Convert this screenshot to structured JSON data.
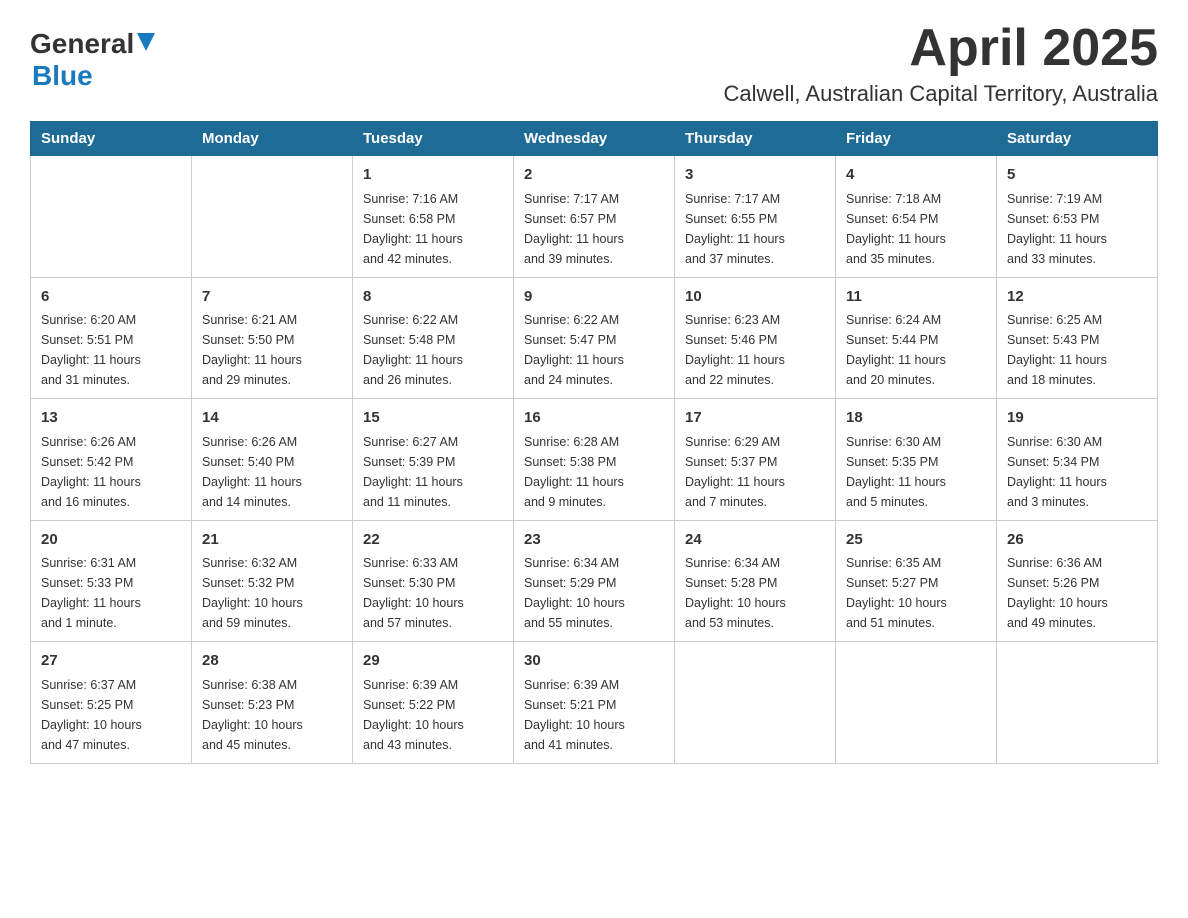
{
  "logo": {
    "general": "General",
    "blue": "Blue"
  },
  "title": "April 2025",
  "subtitle": "Calwell, Australian Capital Territory, Australia",
  "days_of_week": [
    "Sunday",
    "Monday",
    "Tuesday",
    "Wednesday",
    "Thursday",
    "Friday",
    "Saturday"
  ],
  "weeks": [
    [
      {
        "day": "",
        "info": ""
      },
      {
        "day": "",
        "info": ""
      },
      {
        "day": "1",
        "info": "Sunrise: 7:16 AM\nSunset: 6:58 PM\nDaylight: 11 hours\nand 42 minutes."
      },
      {
        "day": "2",
        "info": "Sunrise: 7:17 AM\nSunset: 6:57 PM\nDaylight: 11 hours\nand 39 minutes."
      },
      {
        "day": "3",
        "info": "Sunrise: 7:17 AM\nSunset: 6:55 PM\nDaylight: 11 hours\nand 37 minutes."
      },
      {
        "day": "4",
        "info": "Sunrise: 7:18 AM\nSunset: 6:54 PM\nDaylight: 11 hours\nand 35 minutes."
      },
      {
        "day": "5",
        "info": "Sunrise: 7:19 AM\nSunset: 6:53 PM\nDaylight: 11 hours\nand 33 minutes."
      }
    ],
    [
      {
        "day": "6",
        "info": "Sunrise: 6:20 AM\nSunset: 5:51 PM\nDaylight: 11 hours\nand 31 minutes."
      },
      {
        "day": "7",
        "info": "Sunrise: 6:21 AM\nSunset: 5:50 PM\nDaylight: 11 hours\nand 29 minutes."
      },
      {
        "day": "8",
        "info": "Sunrise: 6:22 AM\nSunset: 5:48 PM\nDaylight: 11 hours\nand 26 minutes."
      },
      {
        "day": "9",
        "info": "Sunrise: 6:22 AM\nSunset: 5:47 PM\nDaylight: 11 hours\nand 24 minutes."
      },
      {
        "day": "10",
        "info": "Sunrise: 6:23 AM\nSunset: 5:46 PM\nDaylight: 11 hours\nand 22 minutes."
      },
      {
        "day": "11",
        "info": "Sunrise: 6:24 AM\nSunset: 5:44 PM\nDaylight: 11 hours\nand 20 minutes."
      },
      {
        "day": "12",
        "info": "Sunrise: 6:25 AM\nSunset: 5:43 PM\nDaylight: 11 hours\nand 18 minutes."
      }
    ],
    [
      {
        "day": "13",
        "info": "Sunrise: 6:26 AM\nSunset: 5:42 PM\nDaylight: 11 hours\nand 16 minutes."
      },
      {
        "day": "14",
        "info": "Sunrise: 6:26 AM\nSunset: 5:40 PM\nDaylight: 11 hours\nand 14 minutes."
      },
      {
        "day": "15",
        "info": "Sunrise: 6:27 AM\nSunset: 5:39 PM\nDaylight: 11 hours\nand 11 minutes."
      },
      {
        "day": "16",
        "info": "Sunrise: 6:28 AM\nSunset: 5:38 PM\nDaylight: 11 hours\nand 9 minutes."
      },
      {
        "day": "17",
        "info": "Sunrise: 6:29 AM\nSunset: 5:37 PM\nDaylight: 11 hours\nand 7 minutes."
      },
      {
        "day": "18",
        "info": "Sunrise: 6:30 AM\nSunset: 5:35 PM\nDaylight: 11 hours\nand 5 minutes."
      },
      {
        "day": "19",
        "info": "Sunrise: 6:30 AM\nSunset: 5:34 PM\nDaylight: 11 hours\nand 3 minutes."
      }
    ],
    [
      {
        "day": "20",
        "info": "Sunrise: 6:31 AM\nSunset: 5:33 PM\nDaylight: 11 hours\nand 1 minute."
      },
      {
        "day": "21",
        "info": "Sunrise: 6:32 AM\nSunset: 5:32 PM\nDaylight: 10 hours\nand 59 minutes."
      },
      {
        "day": "22",
        "info": "Sunrise: 6:33 AM\nSunset: 5:30 PM\nDaylight: 10 hours\nand 57 minutes."
      },
      {
        "day": "23",
        "info": "Sunrise: 6:34 AM\nSunset: 5:29 PM\nDaylight: 10 hours\nand 55 minutes."
      },
      {
        "day": "24",
        "info": "Sunrise: 6:34 AM\nSunset: 5:28 PM\nDaylight: 10 hours\nand 53 minutes."
      },
      {
        "day": "25",
        "info": "Sunrise: 6:35 AM\nSunset: 5:27 PM\nDaylight: 10 hours\nand 51 minutes."
      },
      {
        "day": "26",
        "info": "Sunrise: 6:36 AM\nSunset: 5:26 PM\nDaylight: 10 hours\nand 49 minutes."
      }
    ],
    [
      {
        "day": "27",
        "info": "Sunrise: 6:37 AM\nSunset: 5:25 PM\nDaylight: 10 hours\nand 47 minutes."
      },
      {
        "day": "28",
        "info": "Sunrise: 6:38 AM\nSunset: 5:23 PM\nDaylight: 10 hours\nand 45 minutes."
      },
      {
        "day": "29",
        "info": "Sunrise: 6:39 AM\nSunset: 5:22 PM\nDaylight: 10 hours\nand 43 minutes."
      },
      {
        "day": "30",
        "info": "Sunrise: 6:39 AM\nSunset: 5:21 PM\nDaylight: 10 hours\nand 41 minutes."
      },
      {
        "day": "",
        "info": ""
      },
      {
        "day": "",
        "info": ""
      },
      {
        "day": "",
        "info": ""
      }
    ]
  ]
}
